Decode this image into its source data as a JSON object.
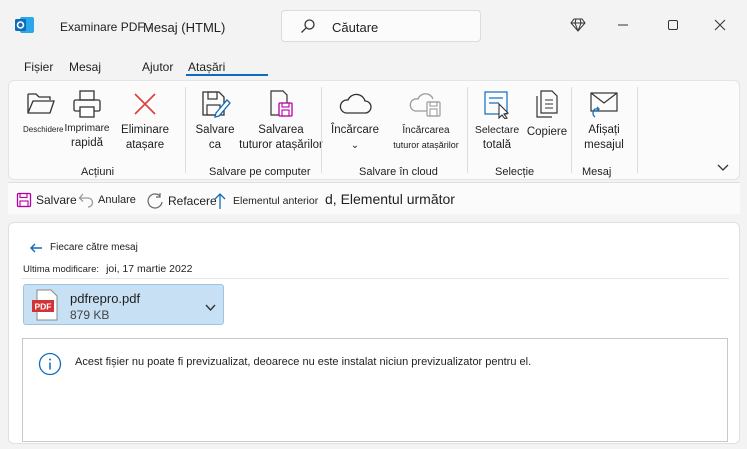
{
  "window": {
    "title_prefix": "Examinare PDF -",
    "title": "Mesaj (HTML)",
    "search_placeholder": "Căutare"
  },
  "tabs": [
    "Fișier",
    "Mesaj",
    "Ajutor",
    "Atașări"
  ],
  "ribbon": {
    "open": "Deschidere",
    "quick_print_l1": "Imprimare",
    "quick_print_l2": "rapidă",
    "remove_l1": "Eliminare",
    "remove_l2": "atașare",
    "actions_group": "Acțiuni",
    "save_as_l1": "Salvare",
    "save_as_l2": "ca",
    "save_all_l1": "Salvarea",
    "save_all_l2": "tuturor atașărilor",
    "save_pc_group": "Salvare pe computer",
    "upload_l1": "Încărcare",
    "upload_l2": "⌄",
    "upload_all_l1": "Încărcarea",
    "upload_all_l2": "tuturor atașărilor",
    "cloud_group": "Salvare în cloud",
    "select_all_l1": "Selectare",
    "select_all_l2": "totală",
    "copy": "Copiere",
    "selection_group": "Selecție",
    "show_msg_l1": "Afișați",
    "show_msg_l2": "mesajul",
    "message_group": "Mesaj"
  },
  "quickbar": {
    "save": "Salvare",
    "undo": "Anulare",
    "redo": "Refacere",
    "prev": "Elementul anterior",
    "next": "d, Elementul următor"
  },
  "main": {
    "back": "Fiecare către mesaj",
    "modified_label": "Ultima modificare:",
    "modified_value": "joi, 17 martie 2022",
    "file_name": "pdfrepro.pdf",
    "file_size": "879 KB",
    "pdf_badge": "PDF",
    "preview_msg": "Acest fișier nu poate fi previzualizat, deoarece nu este instalat niciun previzualizator pentru el."
  },
  "colors": {
    "accent": "#0f6cbd",
    "attachment_bg": "#c7e0f4",
    "pdf_red": "#d13438"
  },
  "icons": [
    "outlook-logo",
    "search-icon",
    "diamond-icon",
    "minimize-icon",
    "maximize-icon",
    "close-icon",
    "folder-open-icon",
    "printer-icon",
    "x-remove-icon",
    "save-edit-icon",
    "save-all-icon",
    "cloud-icon",
    "cloud-save-icon",
    "select-all-icon",
    "copy-icon",
    "envelope-icon",
    "chevron-down-icon",
    "save-icon",
    "undo-icon",
    "redo-icon",
    "arrow-up-icon",
    "arrow-left-icon",
    "pdf-icon",
    "info-icon"
  ]
}
